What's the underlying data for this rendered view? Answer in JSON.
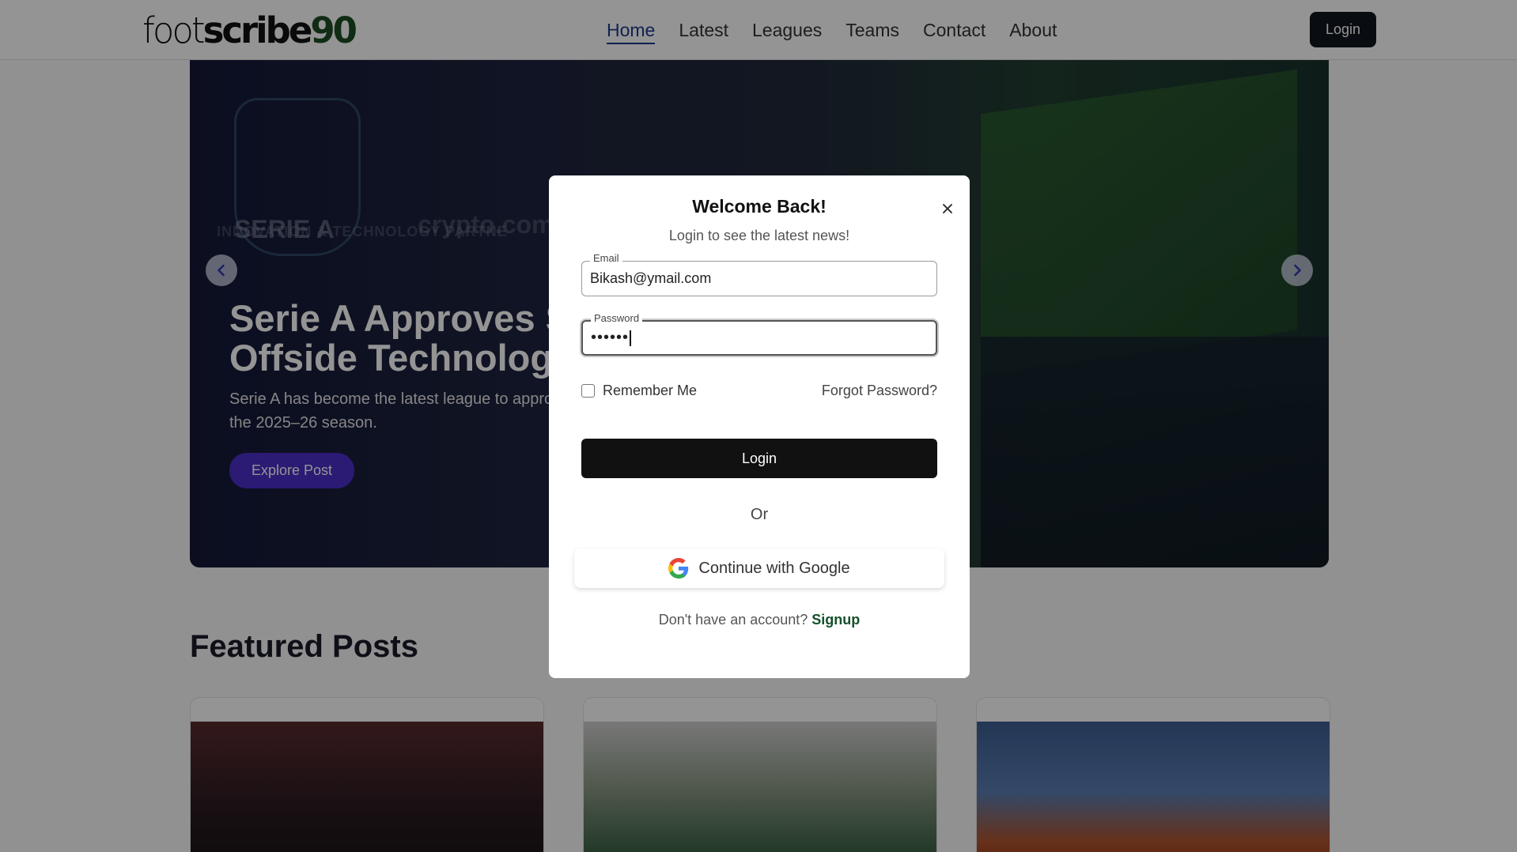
{
  "header": {
    "logo": {
      "part1": "foot",
      "part2": "scribe",
      "part3": "90"
    },
    "nav": [
      {
        "label": "Home",
        "active": true
      },
      {
        "label": "Latest"
      },
      {
        "label": "Leagues"
      },
      {
        "label": "Teams"
      },
      {
        "label": "Contact"
      },
      {
        "label": "About"
      }
    ],
    "login_label": "Login"
  },
  "hero": {
    "title_line1": "Serie A Approves Se",
    "title_line2": "Offside Technology",
    "description_line1": "Serie A has become the latest league to appro",
    "description_line2": "the 2025–26 season.",
    "explore_label": "Explore Post",
    "bg_text": {
      "brand": "SERIE A",
      "sponsor": "crypto.com",
      "tagline": "INNOVATION & TECHNOLOGY PARTNE"
    },
    "prev_icon": "chevron-left-icon",
    "next_icon": "chevron-right-icon"
  },
  "featured": {
    "title": "Featured Posts"
  },
  "modal": {
    "title": "Welcome Back!",
    "subtitle": "Login to see the latest news!",
    "email": {
      "label": "Email",
      "value": "Bikash@ymail.com"
    },
    "password": {
      "label": "Password",
      "value": "••••••"
    },
    "remember_label": "Remember Me",
    "forgot_label": "Forgot Password?",
    "login_label": "Login",
    "or_label": "Or",
    "google_label": "Continue with Google",
    "no_account_text": "Don't have an account?",
    "signup_label": "Signup",
    "close_icon": "close-icon"
  },
  "colors": {
    "accent_purple": "#4a2fc9",
    "dark_button": "#11161d",
    "signup_green": "#14502a",
    "logo_green": "#1d4d24",
    "nav_active": "#1e3a8a"
  }
}
